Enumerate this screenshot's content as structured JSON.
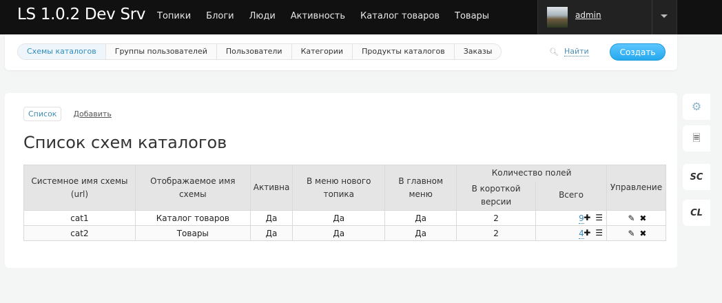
{
  "brand": "LS 1.0.2 Dev Srv",
  "nav": [
    "Топики",
    "Блоги",
    "Люди",
    "Активность",
    "Каталог товаров",
    "Товары"
  ],
  "user": {
    "name": "admin"
  },
  "tabs": [
    "Схемы каталогов",
    "Группы пользователей",
    "Пользователи",
    "Категории",
    "Продукты каталогов",
    "Заказы"
  ],
  "search_label": "Найти",
  "create_label": "Создать",
  "subnav": {
    "list": "Список",
    "add": "Добавить"
  },
  "page_title": "Список схем каталогов",
  "table": {
    "headers": {
      "system_name": "Системное имя схемы (url)",
      "display_name": "Отображаемое имя схемы",
      "active": "Активна",
      "new_topic_menu": "В меню нового топика",
      "main_menu": "В главном меню",
      "fields_count": "Количество полей",
      "short_version": "В короткой версии",
      "total": "Всего",
      "manage": "Управление"
    },
    "rows": [
      {
        "system": "cat1",
        "display": "Каталог товаров",
        "active": "Да",
        "new_topic": "Да",
        "main_menu": "Да",
        "short": "2",
        "total": "9"
      },
      {
        "system": "cat2",
        "display": "Товары",
        "active": "Да",
        "new_topic": "Да",
        "main_menu": "Да",
        "short": "2",
        "total": "4"
      }
    ]
  },
  "right_toolbar": {
    "sc": "SC",
    "cl": "CL"
  },
  "icons": [
    "gear-icon",
    "list-icon",
    "plus-icon",
    "bars-icon",
    "edit-icon",
    "delete-icon",
    "search-icon"
  ]
}
